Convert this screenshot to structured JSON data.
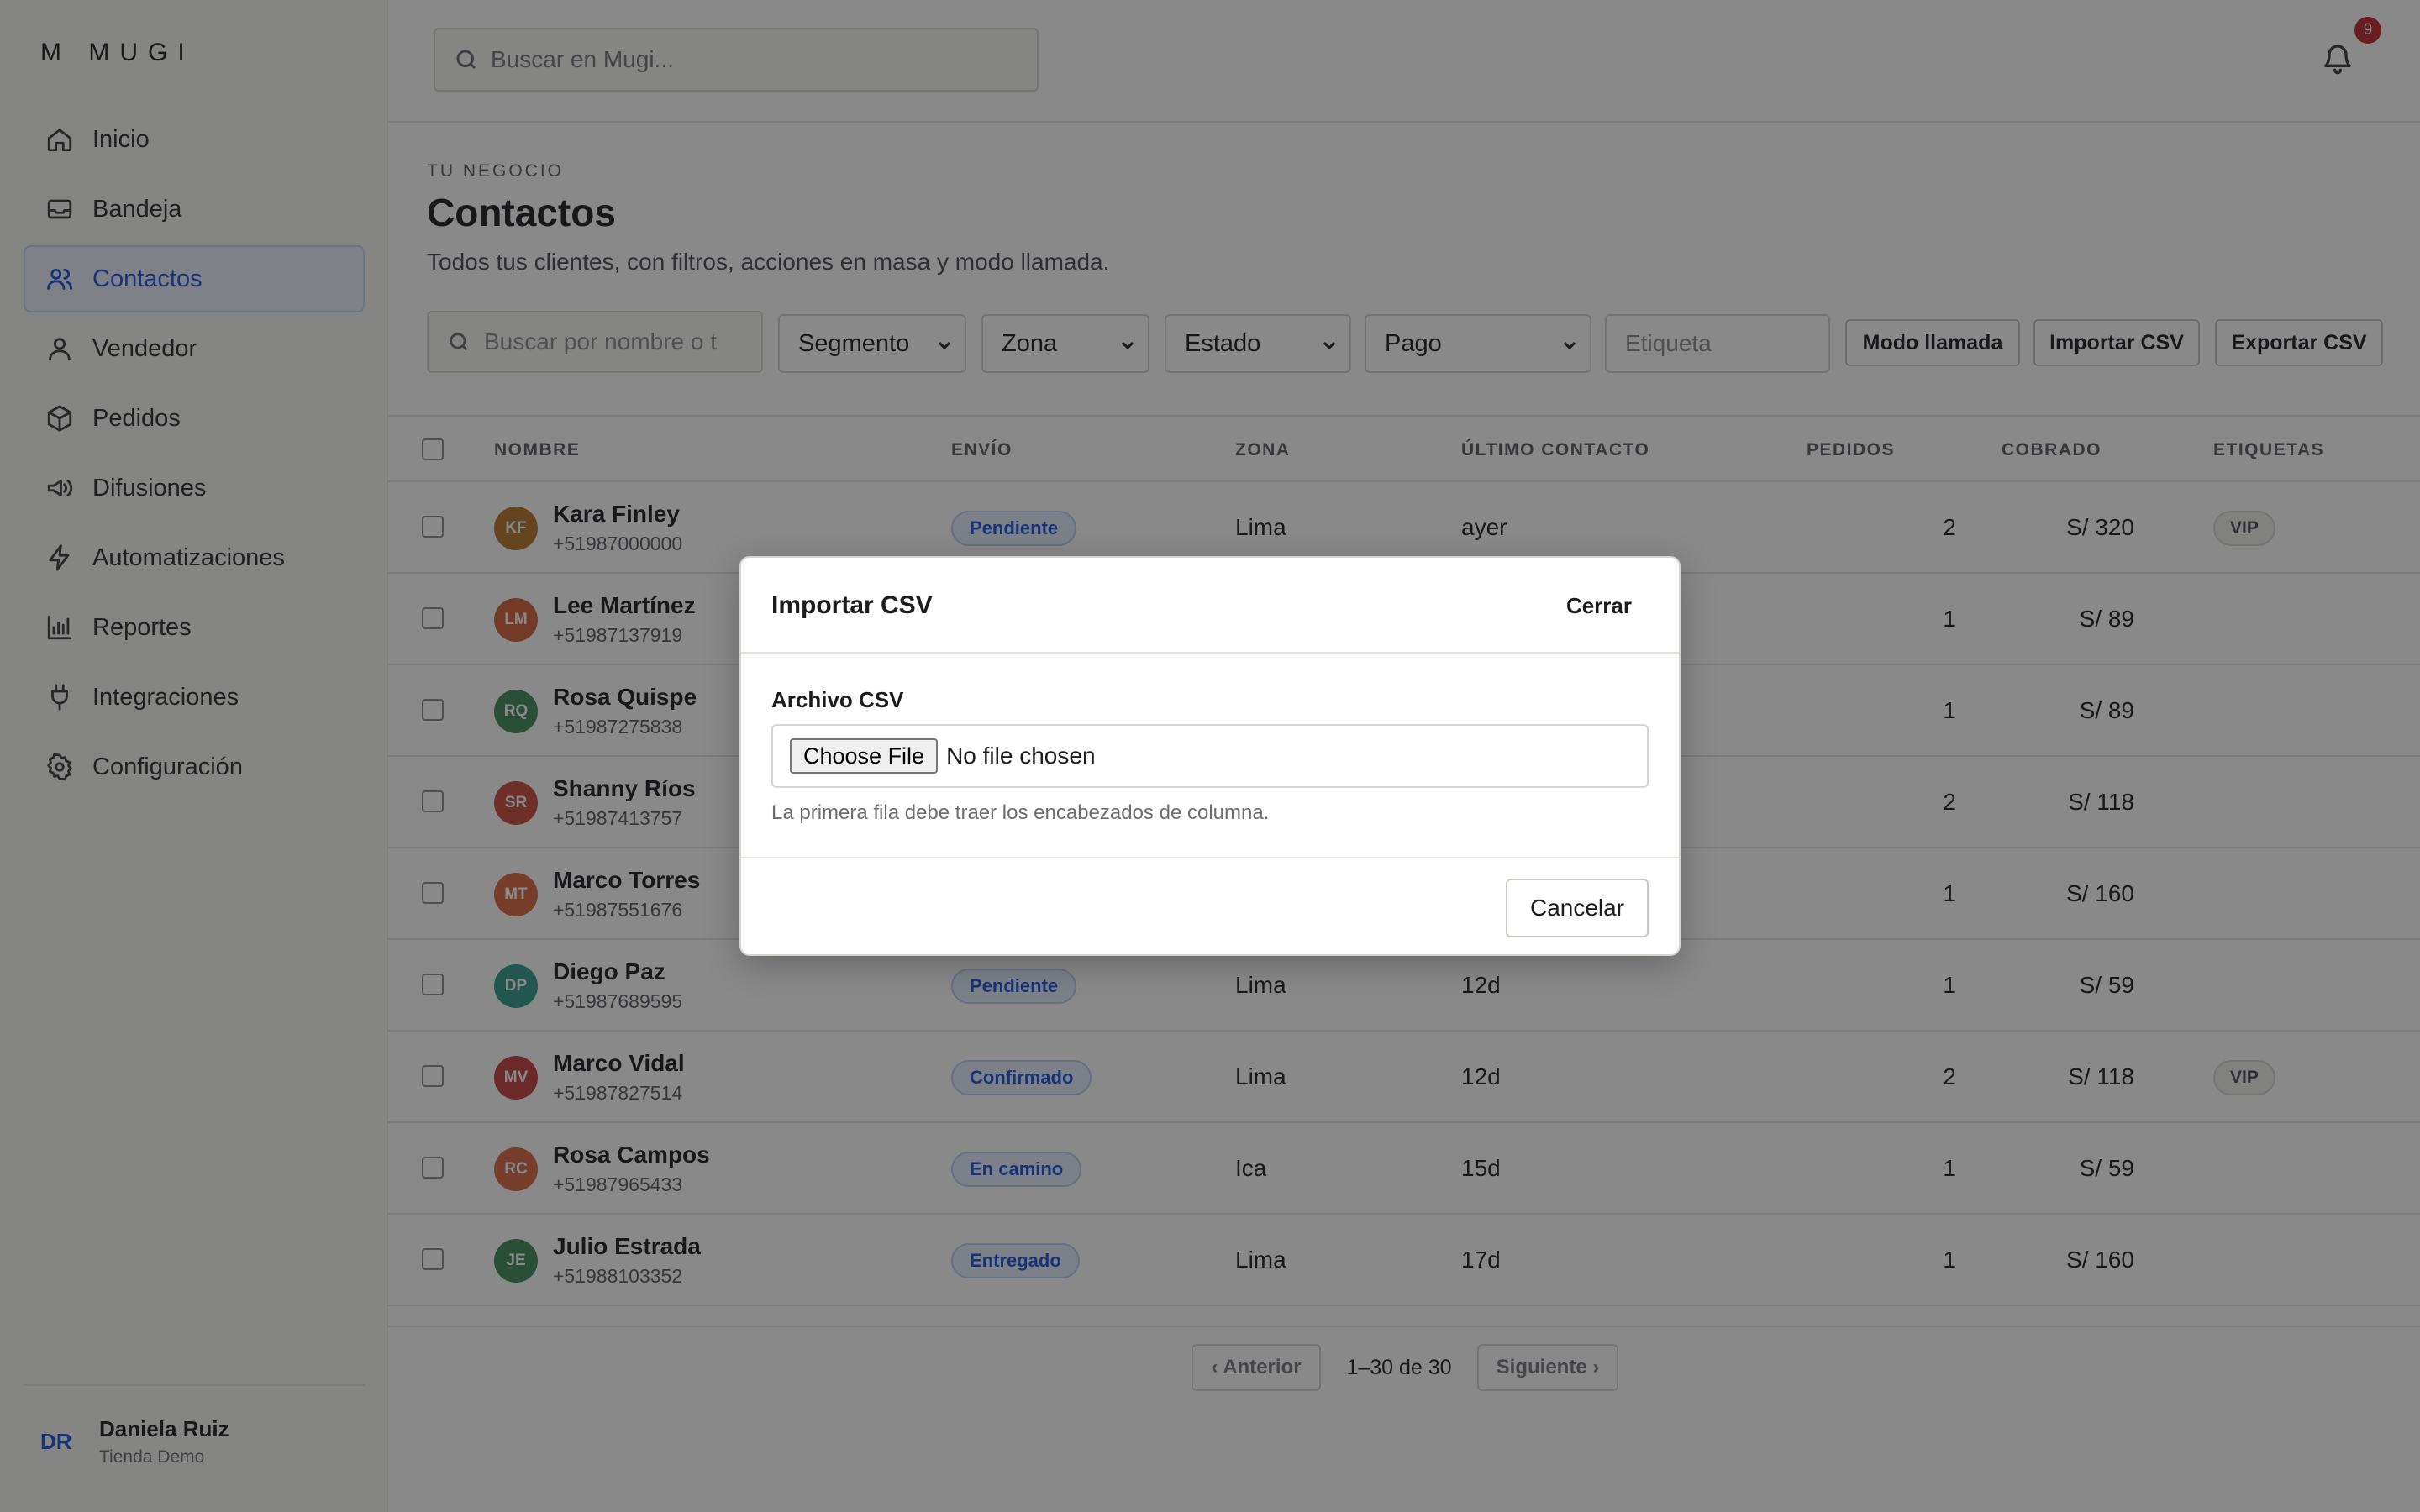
{
  "sidebar": {
    "brand": "M MUGI",
    "items": [
      {
        "label": "Inicio",
        "icon": "home-icon"
      },
      {
        "label": "Bandeja",
        "icon": "inbox-icon"
      },
      {
        "label": "Contactos",
        "icon": "users-icon",
        "active": true
      },
      {
        "label": "Vendedor",
        "icon": "user-icon"
      },
      {
        "label": "Pedidos",
        "icon": "box-icon"
      },
      {
        "label": "Difusiones",
        "icon": "megaphone-icon"
      },
      {
        "label": "Automatizaciones",
        "icon": "bolt-icon"
      },
      {
        "label": "Reportes",
        "icon": "bar-chart-icon"
      },
      {
        "label": "Integraciones",
        "icon": "plug-icon"
      },
      {
        "label": "Configuración",
        "icon": "gear-icon"
      }
    ],
    "user": {
      "initials": "DR",
      "name": "Daniela Ruiz",
      "store": "Tienda Demo"
    }
  },
  "header": {
    "search_placeholder": "Buscar en Mugi...",
    "notification_count": "9"
  },
  "page": {
    "eyebrow": "TU NEGOCIO",
    "title": "Contactos",
    "subtitle": "Todos tus clientes, con filtros, acciones en masa y modo llamada."
  },
  "filters": {
    "search_placeholder": "Buscar por nombre o t",
    "segment": "Segmento",
    "zone": "Zona",
    "status": "Estado",
    "payment": "Pago",
    "tag_placeholder": "Etiqueta",
    "call_mode": "Modo llamada",
    "import_csv": "Importar CSV",
    "export_csv": "Exportar CSV"
  },
  "table": {
    "headers": [
      "NOMBRE",
      "ENVÍO",
      "ZONA",
      "ÚLTIMO CONTACTO",
      "PEDIDOS",
      "COBRADO",
      "ETIQUETAS"
    ],
    "rows": [
      {
        "initials": "KF",
        "color": "#b5762a",
        "name": "Kara Finley",
        "phone": "+51987000000",
        "shipping": "Pendiente",
        "zone": "Lima",
        "last": "ayer",
        "orders": "2",
        "paid": "S/ 320",
        "tag": "VIP"
      },
      {
        "initials": "LM",
        "color": "#d2603a",
        "name": "Lee Martínez",
        "phone": "+51987137919",
        "shipping": "",
        "zone": "",
        "last": "",
        "orders": "1",
        "paid": "S/ 89",
        "tag": ""
      },
      {
        "initials": "RQ",
        "color": "#3f8a5c",
        "name": "Rosa Quispe",
        "phone": "+51987275838",
        "shipping": "",
        "zone": "",
        "last": "",
        "orders": "1",
        "paid": "S/ 89",
        "tag": ""
      },
      {
        "initials": "SR",
        "color": "#c84a3c",
        "name": "Shanny Ríos",
        "phone": "+51987413757",
        "shipping": "",
        "zone": "",
        "last": "",
        "orders": "2",
        "paid": "S/ 118",
        "tag": ""
      },
      {
        "initials": "MT",
        "color": "#d9683e",
        "name": "Marco Torres",
        "phone": "+51987551676",
        "shipping": "",
        "zone": "",
        "last": "",
        "orders": "1",
        "paid": "S/ 160",
        "tag": ""
      },
      {
        "initials": "DP",
        "color": "#2e9a86",
        "name": "Diego Paz",
        "phone": "+51987689595",
        "shipping": "Pendiente",
        "zone": "Lima",
        "last": "12d",
        "orders": "1",
        "paid": "S/ 59",
        "tag": ""
      },
      {
        "initials": "MV",
        "color": "#c23f3f",
        "name": "Marco Vidal",
        "phone": "+51987827514",
        "shipping": "Confirmado",
        "zone": "Lima",
        "last": "12d",
        "orders": "2",
        "paid": "S/ 118",
        "tag": "VIP"
      },
      {
        "initials": "RC",
        "color": "#d9683e",
        "name": "Rosa Campos",
        "phone": "+51987965433",
        "shipping": "En camino",
        "zone": "Ica",
        "last": "15d",
        "orders": "1",
        "paid": "S/ 59",
        "tag": ""
      },
      {
        "initials": "JE",
        "color": "#3f8a5c",
        "name": "Julio Estrada",
        "phone": "+51988103352",
        "shipping": "Entregado",
        "zone": "Lima",
        "last": "17d",
        "orders": "1",
        "paid": "S/ 160",
        "tag": ""
      }
    ]
  },
  "pagination": {
    "prev": "‹ Anterior",
    "range": "1–30 de 30",
    "next": "Siguiente ›"
  },
  "modal": {
    "title": "Importar CSV",
    "close": "Cerrar",
    "label": "Archivo CSV",
    "choose_file": "Choose File",
    "no_file": "No file chosen",
    "help": "La primera fila debe traer los encabezados de columna.",
    "cancel": "Cancelar"
  },
  "colors": {
    "accent": "#1d4fd8",
    "badge": "#c0262d"
  }
}
